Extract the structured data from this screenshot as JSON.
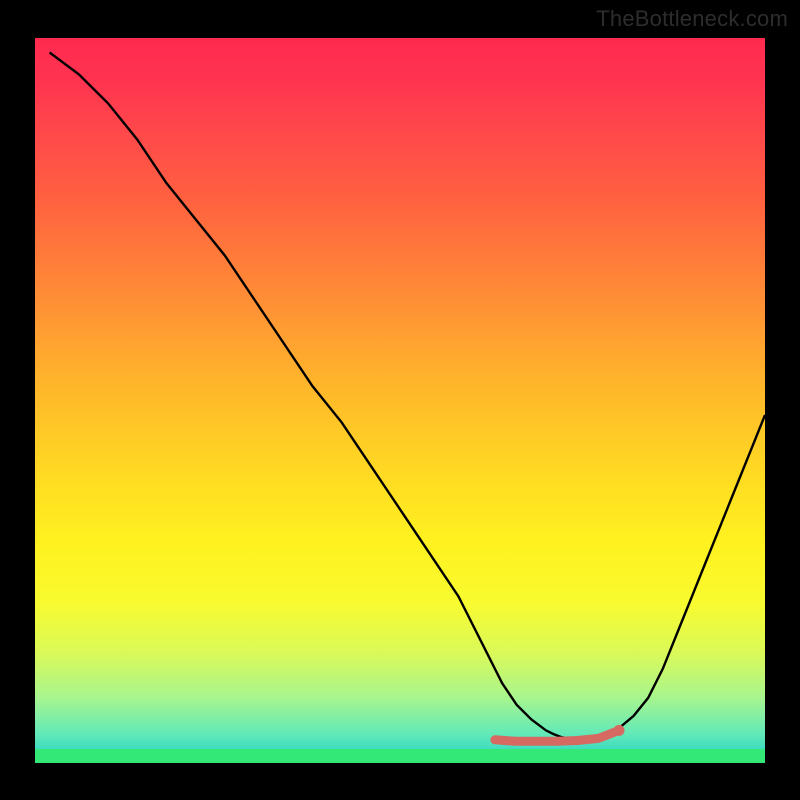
{
  "watermark": "TheBottleneck.com",
  "chart_data": {
    "type": "line",
    "title": "",
    "xlabel": "",
    "ylabel": "",
    "xlim": [
      0,
      100
    ],
    "ylim": [
      0,
      100
    ],
    "x": [
      2,
      6,
      10,
      14,
      18,
      22,
      26,
      30,
      34,
      38,
      42,
      46,
      50,
      54,
      58,
      62,
      64,
      66,
      68,
      70,
      71,
      72,
      74,
      76,
      78,
      80,
      82,
      84,
      86,
      88,
      90,
      92,
      94,
      96,
      98,
      100
    ],
    "values": [
      98,
      95,
      91,
      86,
      80,
      75,
      70,
      64,
      58,
      52,
      47,
      41,
      35,
      29,
      23,
      15,
      11,
      8,
      6,
      4.5,
      4,
      3.6,
      3.2,
      3.0,
      3.5,
      4.8,
      6.5,
      9,
      13,
      18,
      23,
      28,
      33,
      38,
      43,
      48
    ],
    "highlight_region": {
      "x_start": 63,
      "x_end": 80,
      "values": [
        3.2,
        3.0,
        3.0,
        3.0,
        3.1,
        3.4,
        4.5
      ]
    },
    "annotations": [],
    "grid": false,
    "legend": false,
    "background": "vertical-gradient red→yellow→green"
  }
}
